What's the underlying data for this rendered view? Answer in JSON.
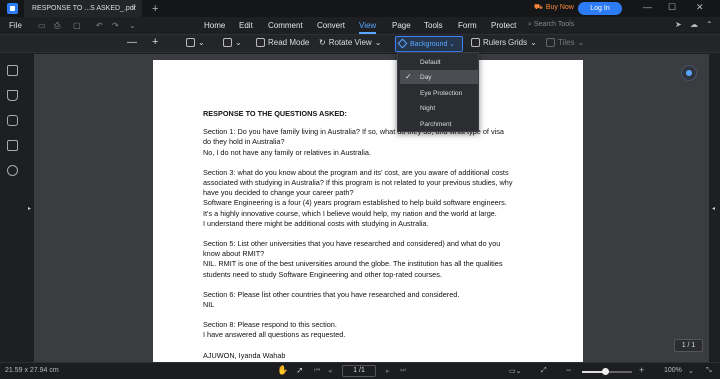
{
  "titlebar": {
    "doc_tab": "RESPONSE TO ...S ASKED_.pdf",
    "close": "×",
    "new_tab": "+",
    "buy_now": "Buy Now",
    "login": "Log In",
    "minimize": "—",
    "maximize": "☐",
    "close_window": "✕"
  },
  "menubar": {
    "file": "File",
    "items": [
      "Home",
      "Edit",
      "Comment",
      "Convert",
      "View",
      "Page",
      "Tools",
      "Form",
      "Protect"
    ],
    "active": "View",
    "search": "Search Tools"
  },
  "toolbar": {
    "zoom_out": "—",
    "zoom_in": "+",
    "read_mode": "Read Mode",
    "rotate_view": "Rotate View",
    "background": "Background",
    "rulers": "Rulers",
    "grids": "Grids",
    "tiles": "Tiles"
  },
  "background_menu": {
    "options": [
      "Default",
      "Day",
      "Eye Protection",
      "Night",
      "Parchment"
    ],
    "selected": "Day"
  },
  "document": {
    "heading": "RESPONSE TO THE QUESTIONS ASKED:",
    "paragraphs": [
      [
        "Section 1: Do you have family living in Australia? If so, what do they do, and what type of visa",
        "do they hold in Australia?",
        "No, I do not have any family or relatives in Australia."
      ],
      [
        "Section 3: what do you know about the program and its' cost, are you aware of additional costs",
        "associated with studying in Australia? If this program is not related to your previous studies, why",
        "have you decided to change your career path?",
        "Software Engineering is a four (4) years program established to help build software engineers.",
        "It's a highly innovative course, which I believe would help, my nation and the world at large.",
        "I understand there might be additional costs with studying in Australia."
      ],
      [
        "Section 5: List other universities that you have researched and considered) and what do you",
        "know about RMIT?",
        "NIL. RMIT is one of the best universities around the globe. The institution has all the qualities",
        "students need to study Software Engineering and other top-rated courses."
      ],
      [
        "Section 6: Please list other countries that you have researched and considered.",
        "NIL"
      ],
      [
        "Section 8: Please respond to this section.",
        "I have answered all questions as requested."
      ],
      [
        "AJUWON, Iyanda Wahab"
      ]
    ]
  },
  "page_indicator": "1 / 1",
  "statusbar": {
    "dimensions": "21.59 x 27.94 cm",
    "page_field": "1 /1",
    "zoom": "100%",
    "zoom_level": 0.45
  },
  "colors": {
    "accent": "#2d7cf6",
    "buy_now": "#ff8a3d",
    "active_tab": "#5aa7ff"
  }
}
